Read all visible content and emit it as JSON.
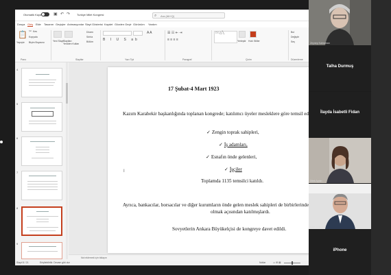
{
  "titlebar": {
    "autosave_label": "Otomatik Kaydet",
    "doc_title": "Turkiye Milet Kongresi",
    "search_placeholder": "Ara (Alt+Q)"
  },
  "menu": [
    "Dosya",
    "Giriş",
    "Ekle",
    "Tasarım",
    "Geçişler",
    "Animasyonlar",
    "Slayt Gösterisi",
    "Kaydet",
    "Gözden Geçir",
    "Görünüm",
    "Yardım"
  ],
  "ribbon": {
    "paste": "Yapıştır",
    "cut": "Kes",
    "copy": "Kopyala",
    "format_painter": "Biçim Boyacısı",
    "new_slide": "Yeni Slayt",
    "reuse_slides": "Slaytları Yeniden Kullan",
    "layout": "Düzen",
    "reset": "Sıfırla",
    "section": "Bölüm",
    "group_clipboard": "Pano",
    "group_slides": "Slaytlar",
    "group_font": "Yazı Tipi",
    "group_paragraph": "Paragraf",
    "group_drawing": "Çizim",
    "group_editing": "Düzenleme",
    "arrange": "Yerleştir",
    "quick_styles": "Hızlı Stiller",
    "find": "Bul",
    "replace": "Değiştir",
    "select": "Seç"
  },
  "thumbnails": [
    {
      "num": "4",
      "selected": false
    },
    {
      "num": "5",
      "selected": false
    },
    {
      "num": "6",
      "selected": false
    },
    {
      "num": "7",
      "selected": false
    },
    {
      "num": "8",
      "selected": true
    },
    {
      "num": "9",
      "selected": false
    }
  ],
  "slide": {
    "title": "17 Şubat-4 Mart 1923",
    "intro": "Kazım Karabekir başkanlığında toplanan kongrede; katılımcı üyeler mesleklere göre temsil edildi",
    "bullets": [
      "Zengin toprak sahipleri,",
      "İş adamları,",
      "Esnafın önde gelenleri,",
      "İşçiler"
    ],
    "total": "Toplamda 1135 temsilci katıldı.",
    "para1": "Ayrıca, bankacılar, borsacılar ve diğer kurumların önde gelen meslek sahipleri  de birbirlerinden",
    "para2": "olmak açısından katılmışlardı.",
    "para3": "Sovyetlerin Ankara Büyükelçisi de kongreye davet edildi."
  },
  "notes_placeholder": "Not eklemek için tıklayın",
  "status": {
    "slide_info": "Slayt 8 / 21",
    "language": "Erişilebilirlik: Devam gibi dur",
    "notes": "Notlar"
  },
  "participants": [
    {
      "name": "Zeynep Kahraman",
      "type": "video"
    },
    {
      "name": "Talha Durmuş",
      "type": "name"
    },
    {
      "name": "İlayda İsabetli Fidan",
      "type": "name"
    },
    {
      "name": "Dilek Aydın",
      "type": "video"
    },
    {
      "name": "Fatih Erdem",
      "type": "video"
    },
    {
      "name": "iPhone",
      "type": "name"
    }
  ],
  "colors": {
    "accent": "#c43e1c",
    "panel": "#1f1f1f"
  }
}
